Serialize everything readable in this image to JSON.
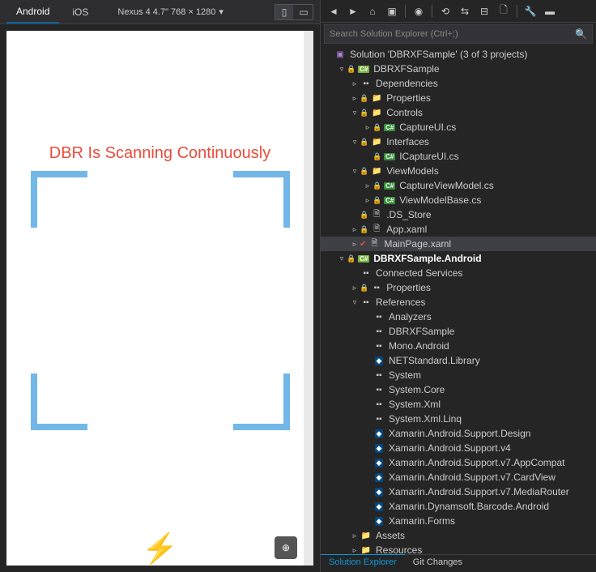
{
  "tabs": {
    "android": "Android",
    "ios": "iOS"
  },
  "device": "Nexus 4  4.7\"  768 × 1280",
  "preview": {
    "scan_text": "DBR Is Scanning Continuously"
  },
  "search": {
    "placeholder": "Search Solution Explorer (Ctrl+;)"
  },
  "bottom_tabs": {
    "solution": "Solution Explorer",
    "git": "Git Changes"
  },
  "tree": [
    {
      "d": 0,
      "exp": "",
      "icon": "sln",
      "label": "Solution 'DBRXFSample' (3 of 3 projects)"
    },
    {
      "d": 1,
      "exp": "▿",
      "icon": "csproj",
      "lock": true,
      "label": "DBRXFSample"
    },
    {
      "d": 2,
      "exp": "▹",
      "icon": "ref",
      "label": "Dependencies"
    },
    {
      "d": 2,
      "exp": "▹",
      "icon": "folder",
      "lock": true,
      "label": "Properties"
    },
    {
      "d": 2,
      "exp": "▿",
      "icon": "folder",
      "lock": true,
      "label": "Controls"
    },
    {
      "d": 3,
      "exp": "▹",
      "icon": "cs",
      "lock": true,
      "label": "CaptureUI.cs"
    },
    {
      "d": 2,
      "exp": "▿",
      "icon": "folder",
      "lock": true,
      "label": "Interfaces"
    },
    {
      "d": 3,
      "exp": "",
      "icon": "cs",
      "lock": true,
      "label": "ICaptureUI.cs"
    },
    {
      "d": 2,
      "exp": "▿",
      "icon": "folder",
      "lock": true,
      "label": "ViewModels"
    },
    {
      "d": 3,
      "exp": "▹",
      "icon": "cs",
      "lock": true,
      "label": "CaptureViewModel.cs"
    },
    {
      "d": 3,
      "exp": "▹",
      "icon": "cs",
      "lock": true,
      "label": "ViewModelBase.cs"
    },
    {
      "d": 2,
      "exp": "",
      "icon": "file",
      "lock": true,
      "label": ".DS_Store"
    },
    {
      "d": 2,
      "exp": "▹",
      "icon": "file",
      "lock": true,
      "label": "App.xaml"
    },
    {
      "d": 2,
      "exp": "▹",
      "icon": "file",
      "check": true,
      "label": "MainPage.xaml",
      "selected": true
    },
    {
      "d": 1,
      "exp": "▿",
      "icon": "csproj",
      "lock": true,
      "label": "DBRXFSample.Android",
      "bold": true
    },
    {
      "d": 2,
      "exp": "",
      "icon": "ref",
      "label": "Connected Services"
    },
    {
      "d": 2,
      "exp": "▹",
      "icon": "ref",
      "lock": true,
      "label": "Properties"
    },
    {
      "d": 2,
      "exp": "▿",
      "icon": "ref",
      "label": "References"
    },
    {
      "d": 3,
      "exp": "",
      "icon": "ref",
      "label": "Analyzers"
    },
    {
      "d": 3,
      "exp": "",
      "icon": "ref",
      "label": "DBRXFSample"
    },
    {
      "d": 3,
      "exp": "",
      "icon": "ref",
      "label": "Mono.Android"
    },
    {
      "d": 3,
      "exp": "",
      "icon": "nuget",
      "label": "NETStandard.Library"
    },
    {
      "d": 3,
      "exp": "",
      "icon": "ref",
      "label": "System"
    },
    {
      "d": 3,
      "exp": "",
      "icon": "ref",
      "label": "System.Core"
    },
    {
      "d": 3,
      "exp": "",
      "icon": "ref",
      "label": "System.Xml"
    },
    {
      "d": 3,
      "exp": "",
      "icon": "ref",
      "label": "System.Xml.Linq"
    },
    {
      "d": 3,
      "exp": "",
      "icon": "nuget",
      "label": "Xamarin.Android.Support.Design"
    },
    {
      "d": 3,
      "exp": "",
      "icon": "nuget",
      "label": "Xamarin.Android.Support.v4"
    },
    {
      "d": 3,
      "exp": "",
      "icon": "nuget",
      "label": "Xamarin.Android.Support.v7.AppCompat"
    },
    {
      "d": 3,
      "exp": "",
      "icon": "nuget",
      "label": "Xamarin.Android.Support.v7.CardView"
    },
    {
      "d": 3,
      "exp": "",
      "icon": "nuget",
      "label": "Xamarin.Android.Support.v7.MediaRouter"
    },
    {
      "d": 3,
      "exp": "",
      "icon": "nuget",
      "label": "Xamarin.Dynamsoft.Barcode.Android"
    },
    {
      "d": 3,
      "exp": "",
      "icon": "nuget",
      "label": "Xamarin.Forms"
    },
    {
      "d": 2,
      "exp": "▹",
      "icon": "folder",
      "label": "Assets"
    },
    {
      "d": 2,
      "exp": "▹",
      "icon": "folder",
      "label": "Resources"
    }
  ]
}
